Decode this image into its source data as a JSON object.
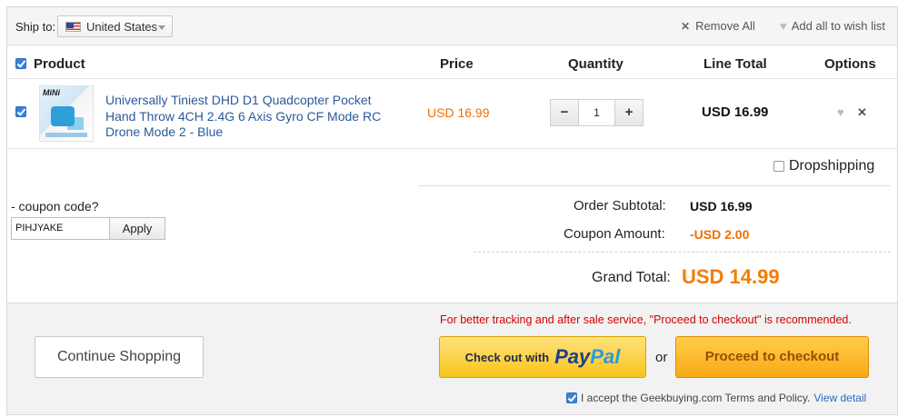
{
  "ship": {
    "label": "Ship to:",
    "country": "United States"
  },
  "toolbar": {
    "remove_all": "Remove All",
    "add_all_wishlist": "Add all to wish list"
  },
  "table": {
    "headers": {
      "product": "Product",
      "price": "Price",
      "quantity": "Quantity",
      "line_total": "Line Total",
      "options": "Options"
    },
    "rows": [
      {
        "thumb_text": "MiNi",
        "name": "Universally Tiniest DHD D1 Quadcopter Pocket Hand Throw 4CH 2.4G 6 Axis Gyro CF Mode RC Drone Mode 2 - Blue",
        "price": "USD 16.99",
        "quantity": "1",
        "line_total": "USD 16.99"
      }
    ]
  },
  "dropshipping": {
    "label": "Dropshipping",
    "checked": false
  },
  "coupon": {
    "label": "- coupon code?",
    "value": "PIHJYAKE",
    "apply_label": "Apply"
  },
  "summary": {
    "subtotal_label": "Order Subtotal:",
    "subtotal_value": "USD 16.99",
    "coupon_label": "Coupon Amount:",
    "coupon_value": "-USD 2.00",
    "grand_label": "Grand Total:",
    "grand_value": "USD 14.99"
  },
  "footer": {
    "continue_label": "Continue Shopping",
    "notice": "For better tracking and after sale service, \"Proceed to checkout\" is recommended.",
    "paypal_text": "Check out with",
    "paypal_logo_pay": "Pay",
    "paypal_logo_pal": "Pal",
    "or": "or",
    "checkout_label": "Proceed to checkout",
    "accept_text": "I accept the Geekbuying.com Terms and Policy.",
    "view_detail": "View detail"
  },
  "colors": {
    "accent_orange": "#f57c00",
    "link_blue": "#2a5a9a",
    "notice_red": "#d40000",
    "paypal_yellow": "#f8c41c"
  }
}
